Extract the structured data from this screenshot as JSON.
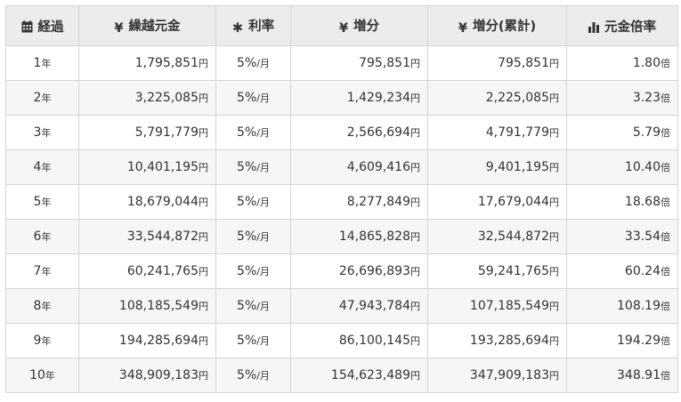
{
  "headers": {
    "elapsed": "経過",
    "principal": "繰越元金",
    "rate": "利率",
    "increase": "増分",
    "cumulative": "増分(累計)",
    "multiple": "元金倍率"
  },
  "icons": {
    "elapsed": "calendar-icon",
    "principal": "yen-icon",
    "rate": "asterisk-icon",
    "increase": "yen-icon",
    "cumulative": "yen-icon",
    "multiple": "bar-chart-icon"
  },
  "rows": [
    {
      "year": "1",
      "year_unit": "年",
      "principal": "1,795,851",
      "rate": "5%",
      "rate_unit": "/月",
      "increase": "795,851",
      "cumulative": "795,851",
      "multiple": "1.80",
      "yen": "円",
      "times": "倍"
    },
    {
      "year": "2",
      "year_unit": "年",
      "principal": "3,225,085",
      "rate": "5%",
      "rate_unit": "/月",
      "increase": "1,429,234",
      "cumulative": "2,225,085",
      "multiple": "3.23",
      "yen": "円",
      "times": "倍"
    },
    {
      "year": "3",
      "year_unit": "年",
      "principal": "5,791,779",
      "rate": "5%",
      "rate_unit": "/月",
      "increase": "2,566,694",
      "cumulative": "4,791,779",
      "multiple": "5.79",
      "yen": "円",
      "times": "倍"
    },
    {
      "year": "4",
      "year_unit": "年",
      "principal": "10,401,195",
      "rate": "5%",
      "rate_unit": "/月",
      "increase": "4,609,416",
      "cumulative": "9,401,195",
      "multiple": "10.40",
      "yen": "円",
      "times": "倍"
    },
    {
      "year": "5",
      "year_unit": "年",
      "principal": "18,679,044",
      "rate": "5%",
      "rate_unit": "/月",
      "increase": "8,277,849",
      "cumulative": "17,679,044",
      "multiple": "18.68",
      "yen": "円",
      "times": "倍"
    },
    {
      "year": "6",
      "year_unit": "年",
      "principal": "33,544,872",
      "rate": "5%",
      "rate_unit": "/月",
      "increase": "14,865,828",
      "cumulative": "32,544,872",
      "multiple": "33.54",
      "yen": "円",
      "times": "倍"
    },
    {
      "year": "7",
      "year_unit": "年",
      "principal": "60,241,765",
      "rate": "5%",
      "rate_unit": "/月",
      "increase": "26,696,893",
      "cumulative": "59,241,765",
      "multiple": "60.24",
      "yen": "円",
      "times": "倍"
    },
    {
      "year": "8",
      "year_unit": "年",
      "principal": "108,185,549",
      "rate": "5%",
      "rate_unit": "/月",
      "increase": "47,943,784",
      "cumulative": "107,185,549",
      "multiple": "108.19",
      "yen": "円",
      "times": "倍"
    },
    {
      "year": "9",
      "year_unit": "年",
      "principal": "194,285,694",
      "rate": "5%",
      "rate_unit": "/月",
      "increase": "86,100,145",
      "cumulative": "193,285,694",
      "multiple": "194.29",
      "yen": "円",
      "times": "倍"
    },
    {
      "year": "10",
      "year_unit": "年",
      "principal": "348,909,183",
      "rate": "5%",
      "rate_unit": "/月",
      "increase": "154,623,489",
      "cumulative": "347,909,183",
      "multiple": "348.91",
      "yen": "円",
      "times": "倍"
    }
  ]
}
